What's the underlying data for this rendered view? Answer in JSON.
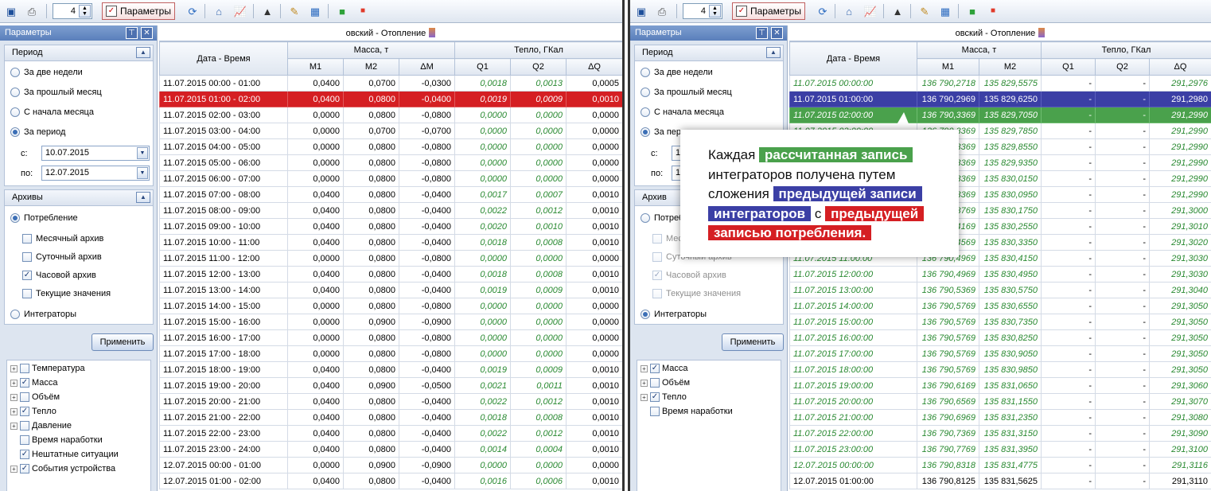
{
  "left": {
    "toolbar": {
      "page_value": "4",
      "params_label": "Параметры"
    },
    "sidebar": {
      "title": "Параметры",
      "period": {
        "title": "Период",
        "options": [
          "За две недели",
          "За прошлый месяц",
          "С начала месяца",
          "За период"
        ],
        "selected": 3,
        "from_label": "с:",
        "from_value": "10.07.2015",
        "to_label": "по:",
        "to_value": "12.07.2015"
      },
      "archives": {
        "title": "Архивы",
        "consumption": "Потребление",
        "items": [
          {
            "label": "Месячный архив",
            "checked": false
          },
          {
            "label": "Суточный архив",
            "checked": false
          },
          {
            "label": "Часовой архив",
            "checked": true
          },
          {
            "label": "Текущие значения",
            "checked": false
          }
        ],
        "integrators": "Интеграторы"
      },
      "apply_label": "Применить",
      "tree": [
        {
          "label": "Температура",
          "expand": true,
          "checked": false
        },
        {
          "label": "Масса",
          "expand": true,
          "checked": true
        },
        {
          "label": "Объём",
          "expand": true,
          "checked": false
        },
        {
          "label": "Тепло",
          "expand": true,
          "checked": true
        },
        {
          "label": "Давление",
          "expand": true,
          "checked": false
        },
        {
          "label": "Время наработки",
          "expand": false,
          "checked": false
        },
        {
          "label": "Нештатные ситуации",
          "expand": false,
          "checked": true
        },
        {
          "label": "События устройства",
          "expand": true,
          "checked": true
        }
      ]
    },
    "grid": {
      "title": "овский - Отопление",
      "col_datetime": "Дата - Время",
      "group_mass": "Масса, т",
      "group_heat": "Тепло, ГКал",
      "cols": [
        "M1",
        "M2",
        "ΔM",
        "Q1",
        "Q2",
        "ΔQ"
      ],
      "rows": [
        [
          "11.07.2015 00:00 - 01:00",
          "0,0400",
          "0,0700",
          "-0,0300",
          "0,0018",
          "0,0013",
          "0,0005"
        ],
        [
          "11.07.2015 01:00 - 02:00",
          "0,0400",
          "0,0800",
          "-0,0400",
          "0,0019",
          "0,0009",
          "0,0010"
        ],
        [
          "11.07.2015 02:00 - 03:00",
          "0,0000",
          "0,0800",
          "-0,0800",
          "0,0000",
          "0,0000",
          "0,0000"
        ],
        [
          "11.07.2015 03:00 - 04:00",
          "0,0000",
          "0,0700",
          "-0,0700",
          "0,0000",
          "0,0000",
          "0,0000"
        ],
        [
          "11.07.2015 04:00 - 05:00",
          "0,0000",
          "0,0800",
          "-0,0800",
          "0,0000",
          "0,0000",
          "0,0000"
        ],
        [
          "11.07.2015 05:00 - 06:00",
          "0,0000",
          "0,0800",
          "-0,0800",
          "0,0000",
          "0,0000",
          "0,0000"
        ],
        [
          "11.07.2015 06:00 - 07:00",
          "0,0000",
          "0,0800",
          "-0,0800",
          "0,0000",
          "0,0000",
          "0,0000"
        ],
        [
          "11.07.2015 07:00 - 08:00",
          "0,0400",
          "0,0800",
          "-0,0400",
          "0,0017",
          "0,0007",
          "0,0010"
        ],
        [
          "11.07.2015 08:00 - 09:00",
          "0,0400",
          "0,0800",
          "-0,0400",
          "0,0022",
          "0,0012",
          "0,0010"
        ],
        [
          "11.07.2015 09:00 - 10:00",
          "0,0400",
          "0,0800",
          "-0,0400",
          "0,0020",
          "0,0010",
          "0,0010"
        ],
        [
          "11.07.2015 10:00 - 11:00",
          "0,0400",
          "0,0800",
          "-0,0400",
          "0,0018",
          "0,0008",
          "0,0010"
        ],
        [
          "11.07.2015 11:00 - 12:00",
          "0,0000",
          "0,0800",
          "-0,0800",
          "0,0000",
          "0,0000",
          "0,0000"
        ],
        [
          "11.07.2015 12:00 - 13:00",
          "0,0400",
          "0,0800",
          "-0,0400",
          "0,0018",
          "0,0008",
          "0,0010"
        ],
        [
          "11.07.2015 13:00 - 14:00",
          "0,0400",
          "0,0800",
          "-0,0400",
          "0,0019",
          "0,0009",
          "0,0010"
        ],
        [
          "11.07.2015 14:00 - 15:00",
          "0,0000",
          "0,0800",
          "-0,0800",
          "0,0000",
          "0,0000",
          "0,0000"
        ],
        [
          "11.07.2015 15:00 - 16:00",
          "0,0000",
          "0,0900",
          "-0,0900",
          "0,0000",
          "0,0000",
          "0,0000"
        ],
        [
          "11.07.2015 16:00 - 17:00",
          "0,0000",
          "0,0800",
          "-0,0800",
          "0,0000",
          "0,0000",
          "0,0000"
        ],
        [
          "11.07.2015 17:00 - 18:00",
          "0,0000",
          "0,0800",
          "-0,0800",
          "0,0000",
          "0,0000",
          "0,0000"
        ],
        [
          "11.07.2015 18:00 - 19:00",
          "0,0400",
          "0,0800",
          "-0,0400",
          "0,0019",
          "0,0009",
          "0,0010"
        ],
        [
          "11.07.2015 19:00 - 20:00",
          "0,0400",
          "0,0900",
          "-0,0500",
          "0,0021",
          "0,0011",
          "0,0010"
        ],
        [
          "11.07.2015 20:00 - 21:00",
          "0,0400",
          "0,0800",
          "-0,0400",
          "0,0022",
          "0,0012",
          "0,0010"
        ],
        [
          "11.07.2015 21:00 - 22:00",
          "0,0400",
          "0,0800",
          "-0,0400",
          "0,0018",
          "0,0008",
          "0,0010"
        ],
        [
          "11.07.2015 22:00 - 23:00",
          "0,0400",
          "0,0800",
          "-0,0400",
          "0,0022",
          "0,0012",
          "0,0010"
        ],
        [
          "11.07.2015 23:00 - 24:00",
          "0,0400",
          "0,0800",
          "-0,0400",
          "0,0014",
          "0,0004",
          "0,0010"
        ],
        [
          "12.07.2015 00:00 - 01:00",
          "0,0000",
          "0,0900",
          "-0,0900",
          "0,0000",
          "0,0000",
          "0,0000"
        ],
        [
          "12.07.2015 01:00 - 02:00",
          "0,0400",
          "0,0800",
          "-0,0400",
          "0,0016",
          "0,0006",
          "0,0010"
        ]
      ],
      "selected_row": 1
    }
  },
  "right": {
    "toolbar": {
      "page_value": "4",
      "params_label": "Параметры"
    },
    "sidebar": {
      "title": "Параметры",
      "period": {
        "title": "Период",
        "options": [
          "За две недели",
          "За прошлый месяц",
          "С начала месяца",
          "За пери"
        ],
        "selected": 3,
        "from_label": "с:",
        "from_value": "1",
        "to_label": "по:",
        "to_value": "1"
      },
      "archives": {
        "title": "Архив",
        "consumption": "Потреб",
        "items": [
          {
            "label": "Меся",
            "checked": false
          },
          {
            "label": "Суточный архив",
            "checked": false
          },
          {
            "label": "Часовой архив",
            "checked": true
          },
          {
            "label": "Текущие значения",
            "checked": false
          }
        ],
        "integrators": "Интеграторы"
      },
      "apply_label": "Применить",
      "tree": [
        {
          "label": "Масса",
          "expand": true,
          "checked": true
        },
        {
          "label": "Объём",
          "expand": true,
          "checked": false
        },
        {
          "label": "Тепло",
          "expand": true,
          "checked": true
        },
        {
          "label": "Время наработки",
          "expand": false,
          "checked": false
        }
      ]
    },
    "grid": {
      "title": "овский - Отопление",
      "col_datetime": "Дата - Время",
      "group_mass": "Масса, т",
      "group_heat": "Тепло, ГКал",
      "cols": [
        "M1",
        "M2",
        "Q1",
        "Q2",
        "ΔQ"
      ],
      "rows": [
        [
          "11.07.2015 00:00:00",
          "136 790,2718",
          "135 829,5575",
          "-",
          "-",
          "291,2976"
        ],
        [
          "11.07.2015 01:00:00",
          "136 790,2969",
          "135 829,6250",
          "-",
          "-",
          "291,2980"
        ],
        [
          "11.07.2015 02:00:00",
          "136 790,3369",
          "135 829,7050",
          "-",
          "-",
          "291,2990"
        ],
        [
          "11.07.2015 03:00:00",
          "136 790,3369",
          "135 829,7850",
          "-",
          "-",
          "291,2990"
        ],
        [
          "11.07.2015 04:00:00",
          "136 790,3369",
          "135 829,8550",
          "-",
          "-",
          "291,2990"
        ],
        [
          "11.07.2015 05:00:00",
          "136 790,3369",
          "135 829,9350",
          "-",
          "-",
          "291,2990"
        ],
        [
          "11.07.2015 06:00:00",
          "136 790,3369",
          "135 830,0150",
          "-",
          "-",
          "291,2990"
        ],
        [
          "11.07.2015 07:00:00",
          "136 790,3369",
          "135 830,0950",
          "-",
          "-",
          "291,2990"
        ],
        [
          "11.07.2015 08:00:00",
          "136 790,3769",
          "135 830,1750",
          "-",
          "-",
          "291,3000"
        ],
        [
          "11.07.2015 09:00:00",
          "136 790,4169",
          "135 830,2550",
          "-",
          "-",
          "291,3010"
        ],
        [
          "11.07.2015 10:00:00",
          "136 790,4569",
          "135 830,3350",
          "-",
          "-",
          "291,3020"
        ],
        [
          "11.07.2015 11:00:00",
          "136 790,4969",
          "135 830,4150",
          "-",
          "-",
          "291,3030"
        ],
        [
          "11.07.2015 12:00:00",
          "136 790,4969",
          "135 830,4950",
          "-",
          "-",
          "291,3030"
        ],
        [
          "11.07.2015 13:00:00",
          "136 790,5369",
          "135 830,5750",
          "-",
          "-",
          "291,3040"
        ],
        [
          "11.07.2015 14:00:00",
          "136 790,5769",
          "135 830,6550",
          "-",
          "-",
          "291,3050"
        ],
        [
          "11.07.2015 15:00:00",
          "136 790,5769",
          "135 830,7350",
          "-",
          "-",
          "291,3050"
        ],
        [
          "11.07.2015 16:00:00",
          "136 790,5769",
          "135 830,8250",
          "-",
          "-",
          "291,3050"
        ],
        [
          "11.07.2015 17:00:00",
          "136 790,5769",
          "135 830,9050",
          "-",
          "-",
          "291,3050"
        ],
        [
          "11.07.2015 18:00:00",
          "136 790,5769",
          "135 830,9850",
          "-",
          "-",
          "291,3050"
        ],
        [
          "11.07.2015 19:00:00",
          "136 790,6169",
          "135 831,0650",
          "-",
          "-",
          "291,3060"
        ],
        [
          "11.07.2015 20:00:00",
          "136 790,6569",
          "135 831,1550",
          "-",
          "-",
          "291,3070"
        ],
        [
          "11.07.2015 21:00:00",
          "136 790,6969",
          "135 831,2350",
          "-",
          "-",
          "291,3080"
        ],
        [
          "11.07.2015 22:00:00",
          "136 790,7369",
          "135 831,3150",
          "-",
          "-",
          "291,3090"
        ],
        [
          "11.07.2015 23:00:00",
          "136 790,7769",
          "135 831,3950",
          "-",
          "-",
          "291,3100"
        ],
        [
          "12.07.2015 00:00:00",
          "136 790,8318",
          "135 831,4775",
          "-",
          "-",
          "291,3116"
        ],
        [
          "12.07.2015 01:00:00",
          "136 790,8125",
          "135 831,5625",
          "-",
          "-",
          "291,3110"
        ]
      ],
      "selected_row": 1,
      "highlight_row": 2
    },
    "callout": {
      "t1": "Каждая",
      "h1": "рассчитанная запись",
      "t2": "интеграторов получена путем",
      "t3": "сложения",
      "h2a": "предыдущей записи",
      "h2b": "интеграторов",
      "t4": "с",
      "h3a": "предыдущей",
      "h3b": "записью потребления."
    }
  },
  "colors": {
    "accent_red": "#d51f23",
    "accent_blue": "#3b3fa5",
    "accent_green": "#4aa14c",
    "calc_text": "#2a8a32"
  }
}
